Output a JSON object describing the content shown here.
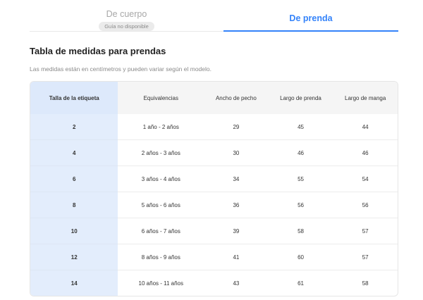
{
  "tabs": {
    "body": {
      "label": "De cuerpo",
      "badge": "Guía no disponible"
    },
    "garment": {
      "label": "De prenda"
    }
  },
  "section": {
    "title": "Tabla de medidas para prendas",
    "subtitle": "Las medidas están en centímetros y pueden variar según el modelo."
  },
  "table": {
    "headers": [
      "Talla de la etiqueta",
      "Equivalencias",
      "Ancho de pecho",
      "Largo de prenda",
      "Largo de manga"
    ],
    "rows": [
      [
        "2",
        "1 año - 2 años",
        "29",
        "45",
        "44"
      ],
      [
        "4",
        "2 años - 3 años",
        "30",
        "46",
        "46"
      ],
      [
        "6",
        "3 años - 4 años",
        "34",
        "55",
        "54"
      ],
      [
        "8",
        "5 años - 6 años",
        "36",
        "56",
        "56"
      ],
      [
        "10",
        "6 años - 7 años",
        "39",
        "58",
        "57"
      ],
      [
        "12",
        "8 años - 9 años",
        "41",
        "60",
        "57"
      ],
      [
        "14",
        "10 años - 11 años",
        "43",
        "61",
        "58"
      ]
    ]
  },
  "colors": {
    "accent": "#3483fa",
    "highlight_column": "#e3edfc"
  }
}
